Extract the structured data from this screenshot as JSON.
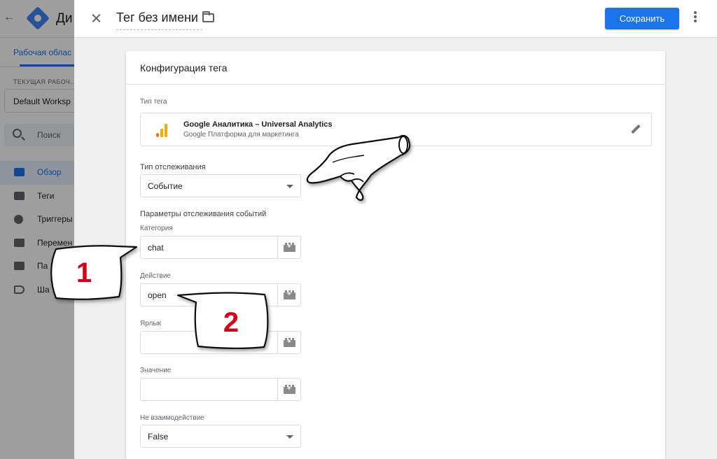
{
  "background": {
    "app_title": "Ди",
    "tab_label": "Рабочая облас",
    "workspace_caption": "ТЕКУЩАЯ РАБОЧ...",
    "workspace_name": "Default Worksp",
    "search_placeholder": "Поиск",
    "nav": [
      {
        "label": "Обзор",
        "icon": "overview-icon",
        "active": true
      },
      {
        "label": "Теги",
        "icon": "tag-icon"
      },
      {
        "label": "Триггеры",
        "icon": "trigger-icon"
      },
      {
        "label": "Перемен",
        "icon": "variable-icon"
      },
      {
        "label": "Па",
        "icon": "folder-icon"
      },
      {
        "label": "Ша",
        "icon": "template-icon"
      }
    ]
  },
  "header": {
    "tag_name": "Тег без имени",
    "save_label": "Сохранить"
  },
  "card": {
    "title": "Конфигурация тега",
    "tag_type_label": "Тип тега",
    "tag_type_name": "Google Аналитика – Universal Analytics",
    "tag_type_sub": "Google Платформа для маркетинга",
    "tracking_type_label": "Тип отслеживания",
    "tracking_type_value": "Событие",
    "event_params_label": "Параметры отслеживания событий",
    "category_label": "Категория",
    "category_value": "chat",
    "action_label": "Действие",
    "action_value": "open",
    "label_label": "Ярлык",
    "label_value": "",
    "value_label": "Значение",
    "value_value": "",
    "non_interaction_label": "Не взаимодействие",
    "non_interaction_value": "False"
  },
  "annotations": {
    "callout_1": "1",
    "callout_2": "2"
  },
  "colors": {
    "primary": "#1a73e8",
    "ga_orange": "#f9ab00",
    "ga_dark_orange": "#e37400",
    "callout_red": "#d0021b"
  }
}
